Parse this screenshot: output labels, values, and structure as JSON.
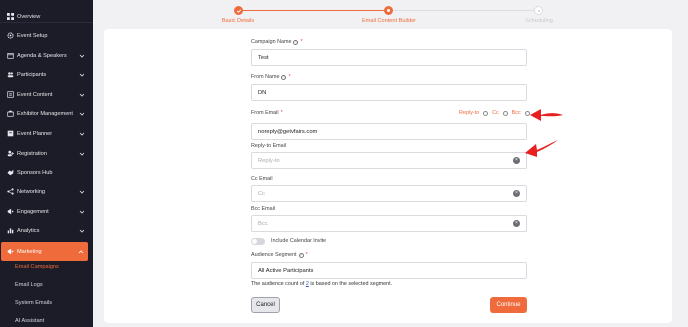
{
  "sidebar": {
    "items": [
      {
        "label": "Overview",
        "icon": "grid-icon"
      },
      {
        "label": "Event Setup",
        "icon": "gear-icon"
      },
      {
        "label": "Agenda & Speakers",
        "icon": "calendar-icon"
      },
      {
        "label": "Participants",
        "icon": "users-icon"
      },
      {
        "label": "Event Content",
        "icon": "content-icon"
      },
      {
        "label": "Exhibitor Management",
        "icon": "booth-icon"
      },
      {
        "label": "Event Planner",
        "icon": "planner-icon"
      },
      {
        "label": "Registration",
        "icon": "user-plus-icon"
      },
      {
        "label": "Sponsors Hub",
        "icon": "handshake-icon"
      },
      {
        "label": "Networking",
        "icon": "network-icon"
      },
      {
        "label": "Engagement",
        "icon": "megaphone-icon"
      },
      {
        "label": "Analytics",
        "icon": "chart-icon"
      },
      {
        "label": "Marketing",
        "icon": "bullhorn-icon"
      }
    ],
    "marketing_sub": [
      "Email Campaigns",
      "Email Logs",
      "System Emails",
      "AI Assistant"
    ]
  },
  "stepper": {
    "steps": [
      "Basic Details",
      "Email Content Builder",
      "Scheduling"
    ],
    "active_color": "#ef6b3b"
  },
  "form": {
    "campaign_name_label": "Campaign Name",
    "campaign_name_value": "Test",
    "from_name_label": "From Name",
    "from_name_value": "DN",
    "from_email_label": "From Email",
    "from_email_value": "noreply@getvfairs.com",
    "reply_to_link": "Reply-to",
    "cc_link": "Cc",
    "bcc_link": "Bcc",
    "reply_to_label": "Reply-to Email",
    "reply_to_placeholder": "Reply-to",
    "cc_label": "Cc Email",
    "cc_placeholder": "Cc",
    "bcc_label": "Bcc Email",
    "bcc_placeholder": "Bcc",
    "calendar_invite_label": "Include Calendar Invite",
    "audience_label": "Audience Segment",
    "audience_value": "All Active Participants",
    "audience_note_prefix": "The audience count of",
    "audience_count": "2",
    "audience_note_suffix": "is based on the selected segment.",
    "required_mark": "*"
  },
  "buttons": {
    "cancel": "Cancel",
    "continue": "Continue"
  },
  "colors": {
    "accent": "#ef6b3b",
    "sidebar_bg": "#1b1c27",
    "annotation_arrow": "#e8201f"
  }
}
